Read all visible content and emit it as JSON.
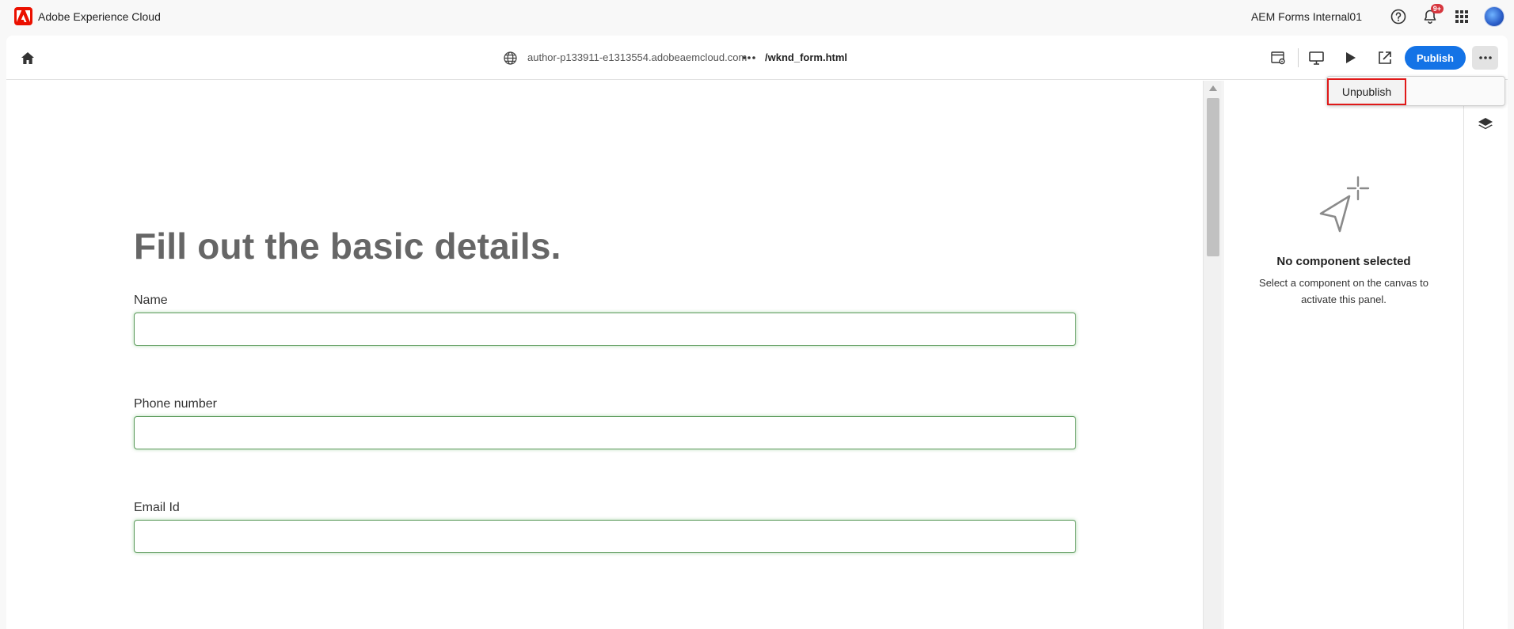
{
  "shell": {
    "product_name": "Adobe Experience Cloud",
    "org_name": "AEM Forms Internal01",
    "notification_count": "9+",
    "icons": [
      "adobe-logo",
      "help-icon",
      "bell-icon",
      "apps-grid-icon",
      "avatar"
    ]
  },
  "toolbar": {
    "url_host": "author-p133911-e1313554.adobeaemcloud.com",
    "url_path": "/wknd_form.html",
    "publish_label": "Publish",
    "icons": [
      "home-icon",
      "globe-icon",
      "ellipsis-icon",
      "page-properties-icon",
      "desktop-preview-icon",
      "play-icon",
      "open-external-icon",
      "more-icon"
    ]
  },
  "menu": {
    "items": [
      {
        "label": "Unpublish"
      }
    ]
  },
  "form": {
    "heading": "Fill out the basic details.",
    "fields": [
      {
        "label": "Name",
        "value": ""
      },
      {
        "label": "Phone number",
        "value": ""
      },
      {
        "label": "Email Id",
        "value": ""
      }
    ]
  },
  "properties_panel": {
    "empty_title": "No component selected",
    "empty_description": "Select a component on the canvas to activate this panel."
  },
  "colors": {
    "accent": "#1473e6",
    "adobe_red": "#eb1000",
    "field_border": "#5b9a5b",
    "highlight_box": "#e01919"
  }
}
